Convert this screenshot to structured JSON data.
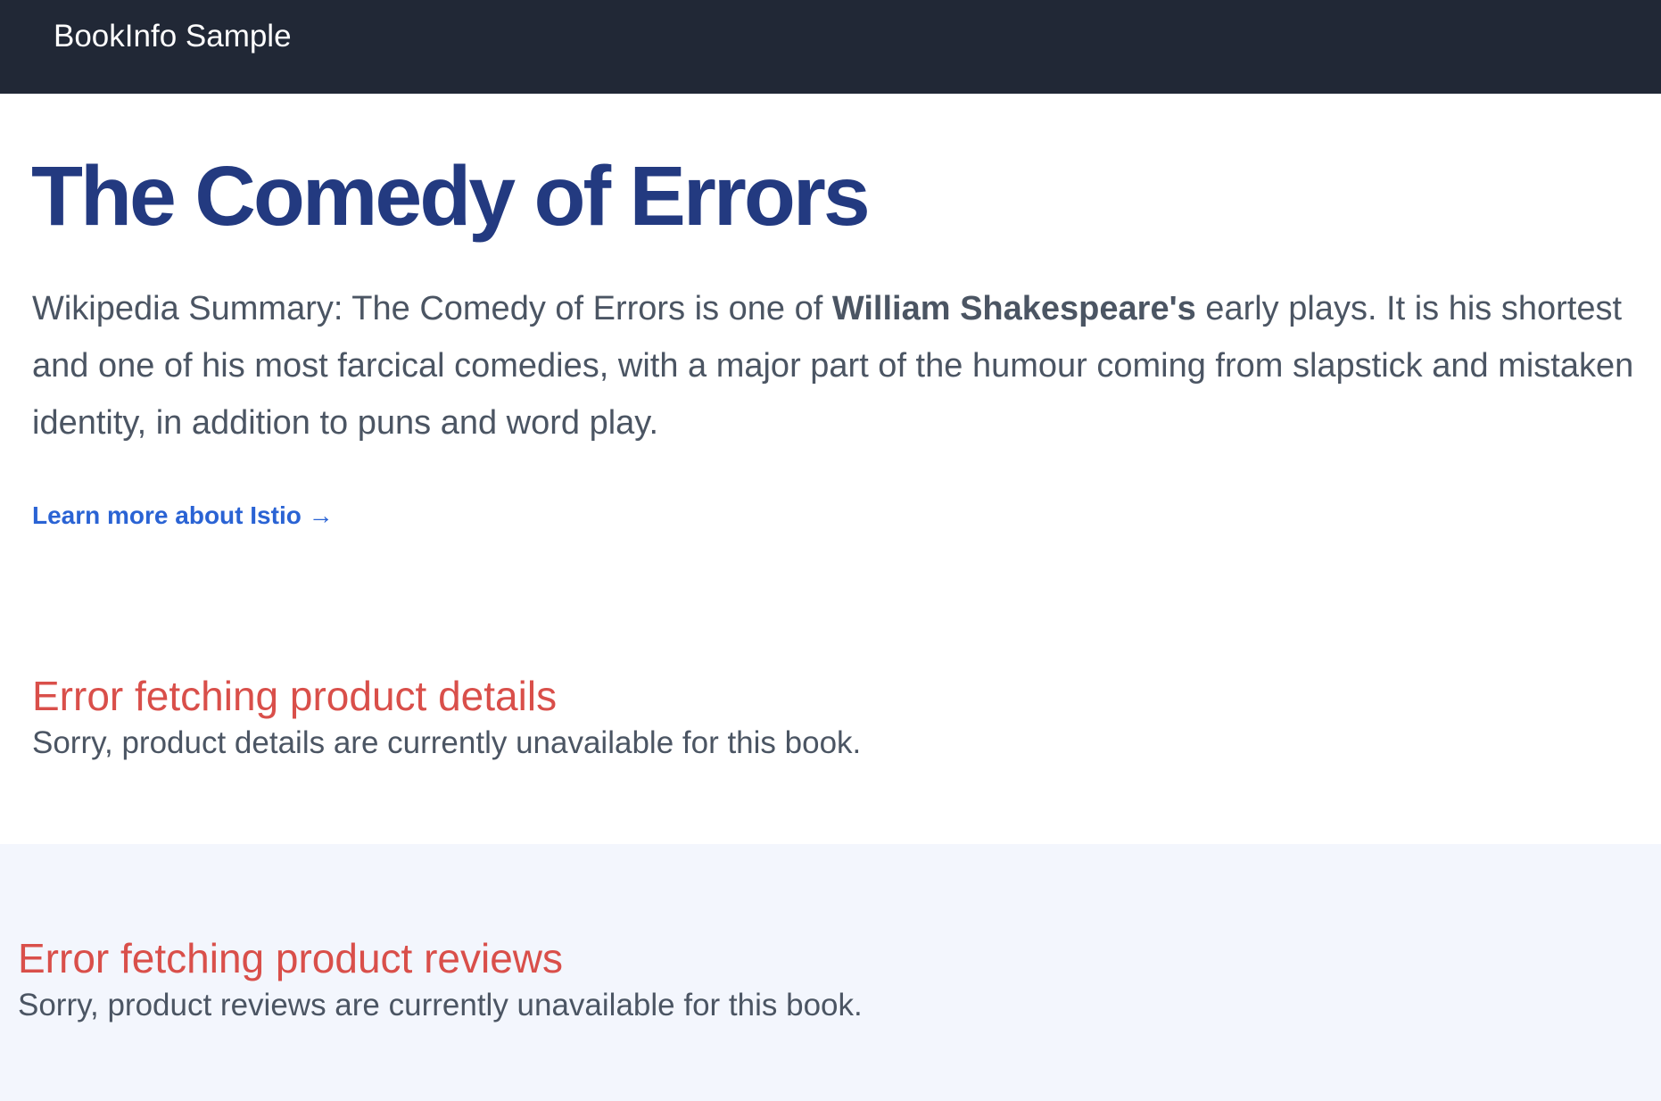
{
  "navbar": {
    "brand": "BookInfo Sample"
  },
  "product": {
    "title": "The Comedy of Errors",
    "summary_prefix": "Wikipedia Summary: The Comedy of Errors is one of ",
    "summary_bold": "William Shakespeare's",
    "summary_suffix": " early plays. It is his shortest and one of his most farcical comedies, with a major part of the humour coming from slapstick and mistaken identity, in addition to puns and word play.",
    "learn_more": "Learn more about Istio →"
  },
  "details": {
    "error_title": "Error fetching product details",
    "error_text": "Sorry, product details are currently unavailable for this book."
  },
  "reviews": {
    "error_title": "Error fetching product reviews",
    "error_text": "Sorry, product reviews are currently unavailable for this book."
  },
  "colors": {
    "navbar_bg": "#212836",
    "title": "#233a80",
    "link": "#2a63d4",
    "error": "#d94f4a",
    "body_text": "#4b5563",
    "reviews_bg": "#f3f6fd"
  }
}
